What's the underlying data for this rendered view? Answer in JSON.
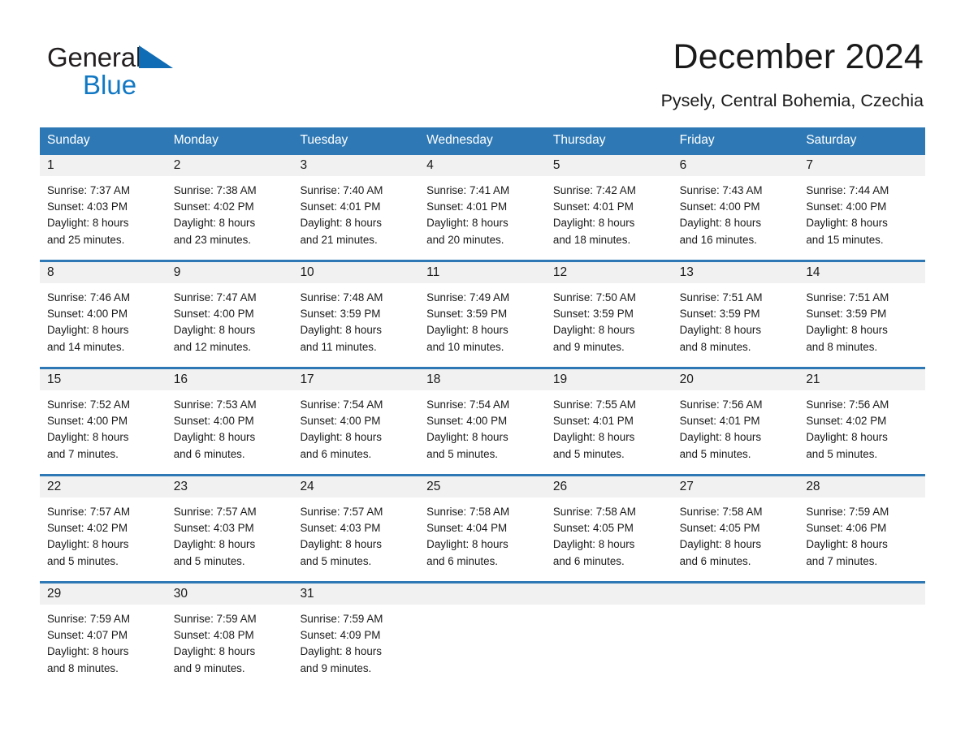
{
  "brand": {
    "name_part1": "General",
    "name_part2": "Blue",
    "triangle_icon": "blue-triangle-icon",
    "accent_color": "#1178c4"
  },
  "header": {
    "title": "December 2024",
    "location": "Pysely, Central Bohemia, Czechia"
  },
  "colors": {
    "header_blue": "#2e79b5",
    "row_divider_blue": "#2e79b5",
    "day_band_gray": "#f1f1f1",
    "text": "#1a1a1a"
  },
  "weekdays": [
    "Sunday",
    "Monday",
    "Tuesday",
    "Wednesday",
    "Thursday",
    "Friday",
    "Saturday"
  ],
  "weeks": [
    [
      {
        "day": "1",
        "sunrise": "Sunrise: 7:37 AM",
        "sunset": "Sunset: 4:03 PM",
        "daylight1": "Daylight: 8 hours",
        "daylight2": "and 25 minutes."
      },
      {
        "day": "2",
        "sunrise": "Sunrise: 7:38 AM",
        "sunset": "Sunset: 4:02 PM",
        "daylight1": "Daylight: 8 hours",
        "daylight2": "and 23 minutes."
      },
      {
        "day": "3",
        "sunrise": "Sunrise: 7:40 AM",
        "sunset": "Sunset: 4:01 PM",
        "daylight1": "Daylight: 8 hours",
        "daylight2": "and 21 minutes."
      },
      {
        "day": "4",
        "sunrise": "Sunrise: 7:41 AM",
        "sunset": "Sunset: 4:01 PM",
        "daylight1": "Daylight: 8 hours",
        "daylight2": "and 20 minutes."
      },
      {
        "day": "5",
        "sunrise": "Sunrise: 7:42 AM",
        "sunset": "Sunset: 4:01 PM",
        "daylight1": "Daylight: 8 hours",
        "daylight2": "and 18 minutes."
      },
      {
        "day": "6",
        "sunrise": "Sunrise: 7:43 AM",
        "sunset": "Sunset: 4:00 PM",
        "daylight1": "Daylight: 8 hours",
        "daylight2": "and 16 minutes."
      },
      {
        "day": "7",
        "sunrise": "Sunrise: 7:44 AM",
        "sunset": "Sunset: 4:00 PM",
        "daylight1": "Daylight: 8 hours",
        "daylight2": "and 15 minutes."
      }
    ],
    [
      {
        "day": "8",
        "sunrise": "Sunrise: 7:46 AM",
        "sunset": "Sunset: 4:00 PM",
        "daylight1": "Daylight: 8 hours",
        "daylight2": "and 14 minutes."
      },
      {
        "day": "9",
        "sunrise": "Sunrise: 7:47 AM",
        "sunset": "Sunset: 4:00 PM",
        "daylight1": "Daylight: 8 hours",
        "daylight2": "and 12 minutes."
      },
      {
        "day": "10",
        "sunrise": "Sunrise: 7:48 AM",
        "sunset": "Sunset: 3:59 PM",
        "daylight1": "Daylight: 8 hours",
        "daylight2": "and 11 minutes."
      },
      {
        "day": "11",
        "sunrise": "Sunrise: 7:49 AM",
        "sunset": "Sunset: 3:59 PM",
        "daylight1": "Daylight: 8 hours",
        "daylight2": "and 10 minutes."
      },
      {
        "day": "12",
        "sunrise": "Sunrise: 7:50 AM",
        "sunset": "Sunset: 3:59 PM",
        "daylight1": "Daylight: 8 hours",
        "daylight2": "and 9 minutes."
      },
      {
        "day": "13",
        "sunrise": "Sunrise: 7:51 AM",
        "sunset": "Sunset: 3:59 PM",
        "daylight1": "Daylight: 8 hours",
        "daylight2": "and 8 minutes."
      },
      {
        "day": "14",
        "sunrise": "Sunrise: 7:51 AM",
        "sunset": "Sunset: 3:59 PM",
        "daylight1": "Daylight: 8 hours",
        "daylight2": "and 8 minutes."
      }
    ],
    [
      {
        "day": "15",
        "sunrise": "Sunrise: 7:52 AM",
        "sunset": "Sunset: 4:00 PM",
        "daylight1": "Daylight: 8 hours",
        "daylight2": "and 7 minutes."
      },
      {
        "day": "16",
        "sunrise": "Sunrise: 7:53 AM",
        "sunset": "Sunset: 4:00 PM",
        "daylight1": "Daylight: 8 hours",
        "daylight2": "and 6 minutes."
      },
      {
        "day": "17",
        "sunrise": "Sunrise: 7:54 AM",
        "sunset": "Sunset: 4:00 PM",
        "daylight1": "Daylight: 8 hours",
        "daylight2": "and 6 minutes."
      },
      {
        "day": "18",
        "sunrise": "Sunrise: 7:54 AM",
        "sunset": "Sunset: 4:00 PM",
        "daylight1": "Daylight: 8 hours",
        "daylight2": "and 5 minutes."
      },
      {
        "day": "19",
        "sunrise": "Sunrise: 7:55 AM",
        "sunset": "Sunset: 4:01 PM",
        "daylight1": "Daylight: 8 hours",
        "daylight2": "and 5 minutes."
      },
      {
        "day": "20",
        "sunrise": "Sunrise: 7:56 AM",
        "sunset": "Sunset: 4:01 PM",
        "daylight1": "Daylight: 8 hours",
        "daylight2": "and 5 minutes."
      },
      {
        "day": "21",
        "sunrise": "Sunrise: 7:56 AM",
        "sunset": "Sunset: 4:02 PM",
        "daylight1": "Daylight: 8 hours",
        "daylight2": "and 5 minutes."
      }
    ],
    [
      {
        "day": "22",
        "sunrise": "Sunrise: 7:57 AM",
        "sunset": "Sunset: 4:02 PM",
        "daylight1": "Daylight: 8 hours",
        "daylight2": "and 5 minutes."
      },
      {
        "day": "23",
        "sunrise": "Sunrise: 7:57 AM",
        "sunset": "Sunset: 4:03 PM",
        "daylight1": "Daylight: 8 hours",
        "daylight2": "and 5 minutes."
      },
      {
        "day": "24",
        "sunrise": "Sunrise: 7:57 AM",
        "sunset": "Sunset: 4:03 PM",
        "daylight1": "Daylight: 8 hours",
        "daylight2": "and 5 minutes."
      },
      {
        "day": "25",
        "sunrise": "Sunrise: 7:58 AM",
        "sunset": "Sunset: 4:04 PM",
        "daylight1": "Daylight: 8 hours",
        "daylight2": "and 6 minutes."
      },
      {
        "day": "26",
        "sunrise": "Sunrise: 7:58 AM",
        "sunset": "Sunset: 4:05 PM",
        "daylight1": "Daylight: 8 hours",
        "daylight2": "and 6 minutes."
      },
      {
        "day": "27",
        "sunrise": "Sunrise: 7:58 AM",
        "sunset": "Sunset: 4:05 PM",
        "daylight1": "Daylight: 8 hours",
        "daylight2": "and 6 minutes."
      },
      {
        "day": "28",
        "sunrise": "Sunrise: 7:59 AM",
        "sunset": "Sunset: 4:06 PM",
        "daylight1": "Daylight: 8 hours",
        "daylight2": "and 7 minutes."
      }
    ],
    [
      {
        "day": "29",
        "sunrise": "Sunrise: 7:59 AM",
        "sunset": "Sunset: 4:07 PM",
        "daylight1": "Daylight: 8 hours",
        "daylight2": "and 8 minutes."
      },
      {
        "day": "30",
        "sunrise": "Sunrise: 7:59 AM",
        "sunset": "Sunset: 4:08 PM",
        "daylight1": "Daylight: 8 hours",
        "daylight2": "and 9 minutes."
      },
      {
        "day": "31",
        "sunrise": "Sunrise: 7:59 AM",
        "sunset": "Sunset: 4:09 PM",
        "daylight1": "Daylight: 8 hours",
        "daylight2": "and 9 minutes."
      },
      {
        "day": "",
        "sunrise": "",
        "sunset": "",
        "daylight1": "",
        "daylight2": ""
      },
      {
        "day": "",
        "sunrise": "",
        "sunset": "",
        "daylight1": "",
        "daylight2": ""
      },
      {
        "day": "",
        "sunrise": "",
        "sunset": "",
        "daylight1": "",
        "daylight2": ""
      },
      {
        "day": "",
        "sunrise": "",
        "sunset": "",
        "daylight1": "",
        "daylight2": ""
      }
    ]
  ]
}
